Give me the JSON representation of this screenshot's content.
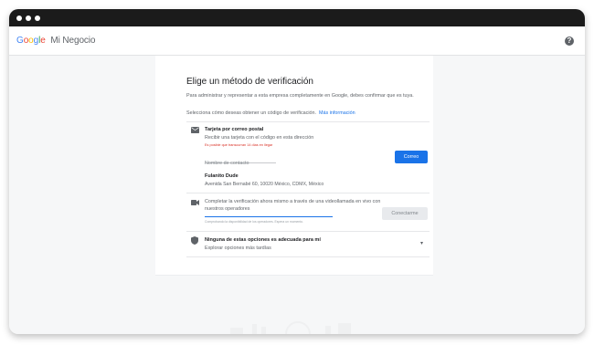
{
  "window": {
    "controls": [
      "dot",
      "dot",
      "dot"
    ]
  },
  "header": {
    "logo_letters": [
      "G",
      "o",
      "o",
      "g",
      "l",
      "e"
    ],
    "product": "Mi Negocio",
    "help_icon": "help-circle-icon",
    "help_glyph": "?"
  },
  "card": {
    "title": "Elige un método de verificación",
    "intro": "Para administrar y representar a esta empresa completamente en Google, debes confirmar que es tuya.",
    "choose_text": "Selecciona cómo deseas obtener un código de verificación.",
    "more_info": "Más información",
    "mail_option": {
      "icon": "mail-icon",
      "title": "Tarjeta por correo postal",
      "subtitle": "Recibir una tarjeta con el código en esta dirección",
      "warning": "Es posible que transcurran 14 días en llegar",
      "contact_placeholder": "Nombre de contacto",
      "contact_value": "",
      "button_label": "Correo",
      "business_name": "Fulanito Dude",
      "address": "Avenida San Bernabé 60, 10020 México, CDMX, México"
    },
    "video_option": {
      "icon": "videocam-icon",
      "text": "Completar la verificación ahora mismo a través de una videollamada en vivo con nuestros operadores",
      "note": "Comprobando la disponibilidad de los operadores. Espera un momento.",
      "button_label": "Conectarme"
    },
    "none_option": {
      "icon": "shield-icon",
      "title": "Ninguna de estas opciones es adecuada para mí",
      "subtitle": "Explorar opciones más tardías",
      "chevron": "▾"
    }
  },
  "colors": {
    "accent": "#1a73e8",
    "warning": "#d93025",
    "titlebar": "#1b1b1b"
  }
}
